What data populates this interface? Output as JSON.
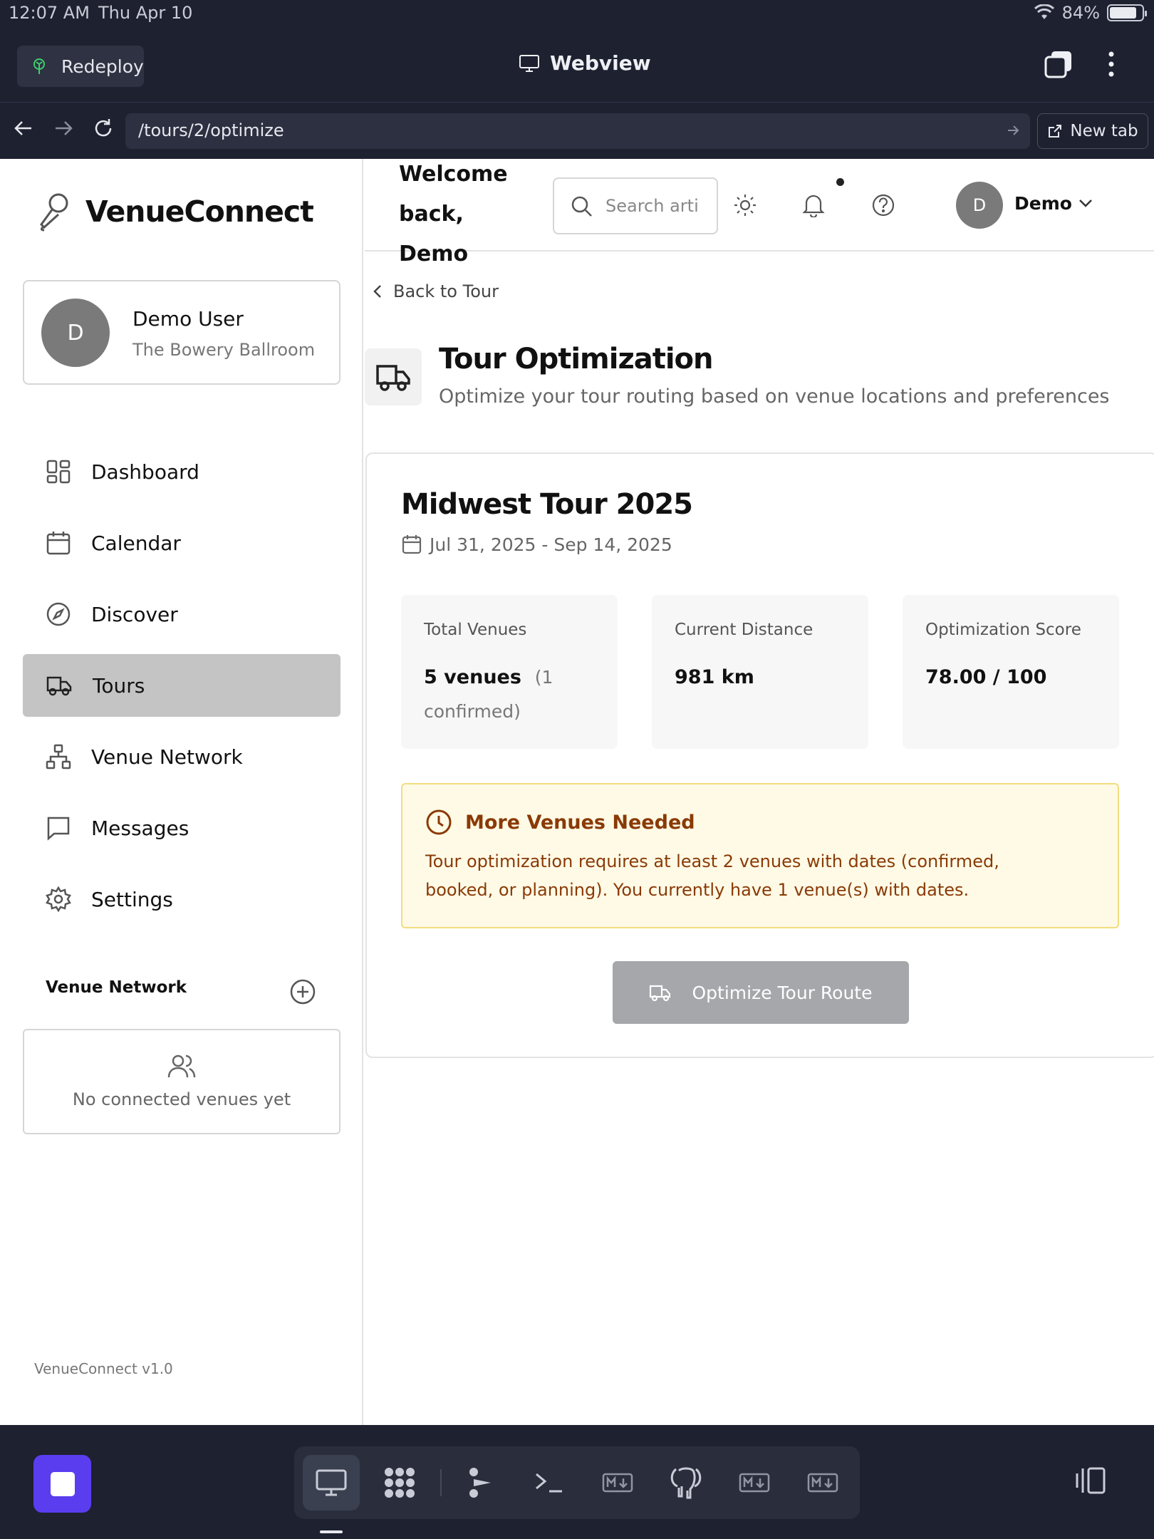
{
  "status_bar": {
    "time": "12:07 AM",
    "date": "Thu Apr 10",
    "battery": "84%",
    "battery_level": 0.84
  },
  "webview": {
    "redeploy_label": "Redeploy",
    "title": "Webview",
    "url": "/tours/2/optimize",
    "new_tab_label": "New tab"
  },
  "sidebar": {
    "brand": "VenueConnect",
    "user": {
      "initial": "D",
      "name": "Demo User",
      "venue": "The Bowery Ballroom"
    },
    "nav": [
      {
        "label": "Dashboard",
        "icon": "dashboard-icon"
      },
      {
        "label": "Calendar",
        "icon": "calendar-icon"
      },
      {
        "label": "Discover",
        "icon": "compass-icon"
      },
      {
        "label": "Tours",
        "icon": "truck-icon",
        "active": true
      },
      {
        "label": "Venue Network",
        "icon": "network-icon"
      },
      {
        "label": "Messages",
        "icon": "message-icon"
      },
      {
        "label": "Settings",
        "icon": "gear-icon"
      }
    ],
    "venue_network_title": "Venue Network",
    "venue_network_empty": "No connected venues yet",
    "version": "VenueConnect v1.0"
  },
  "header": {
    "welcome": "Welcome back, Demo",
    "search_placeholder": "Search artists",
    "user_initial": "D",
    "user_name": "Demo"
  },
  "main": {
    "back_label": "Back to Tour",
    "title": "Tour Optimization",
    "subtitle": "Optimize your tour routing based on venue locations and preferences",
    "tour": {
      "name": "Midwest Tour 2025",
      "dates": "Jul 31, 2025 - Sep 14, 2025",
      "stats": [
        {
          "label": "Total Venues",
          "value": "5 venues",
          "note": "(1 confirmed)"
        },
        {
          "label": "Current Distance",
          "value": "981 km",
          "note": ""
        },
        {
          "label": "Optimization Score",
          "value": "78.00 / 100",
          "note": ""
        }
      ],
      "alert": {
        "title": "More Venues Needed",
        "body": "Tour optimization requires at least 2 venues with dates (confirmed, booked, or planning). You currently have 1 venue(s) with dates."
      },
      "optimize_button": "Optimize Tour Route"
    }
  },
  "colors": {
    "accent": "#5b3df0",
    "alert_bg": "#fffae6",
    "alert_border": "#f2dc7e",
    "alert_text": "#8a3a06",
    "active_nav": "#c4c4c4",
    "disabled_button": "#a6a7ab"
  }
}
